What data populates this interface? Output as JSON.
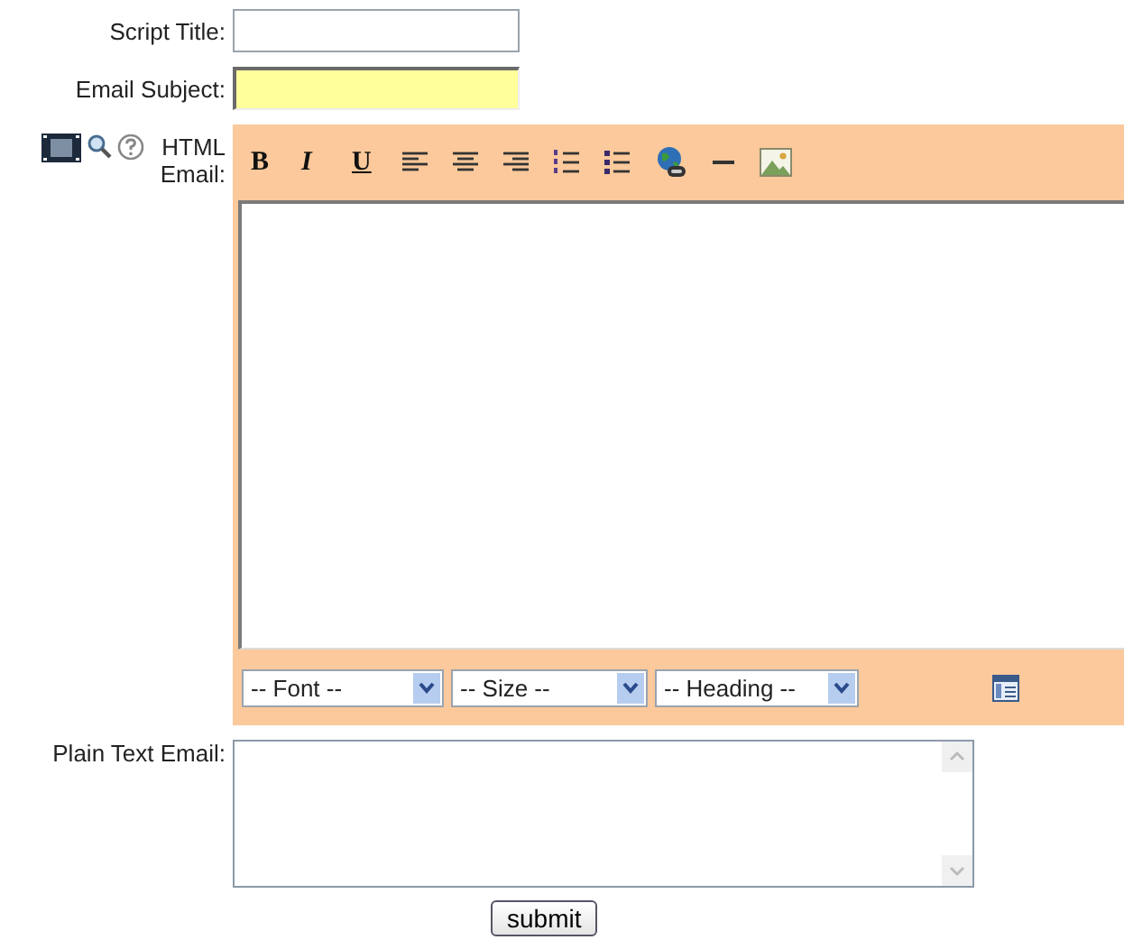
{
  "fields": [
    {
      "label": "Script Title:",
      "highlighted": false
    },
    {
      "label": "Email Subject:",
      "highlighted": true
    }
  ],
  "html_email": {
    "label": "HTML Email:",
    "format_buttons": [
      {
        "label": "B",
        "kind": "bold"
      },
      {
        "label": "I",
        "kind": "italic"
      },
      {
        "label": "U",
        "kind": "underline"
      }
    ],
    "dropdowns": [
      {
        "label": "-- Font --"
      },
      {
        "label": "-- Size --"
      },
      {
        "label": "-- Heading --"
      }
    ]
  },
  "plain_text": {
    "label": "Plain Text Email:"
  },
  "submit": {
    "label": "submit"
  }
}
